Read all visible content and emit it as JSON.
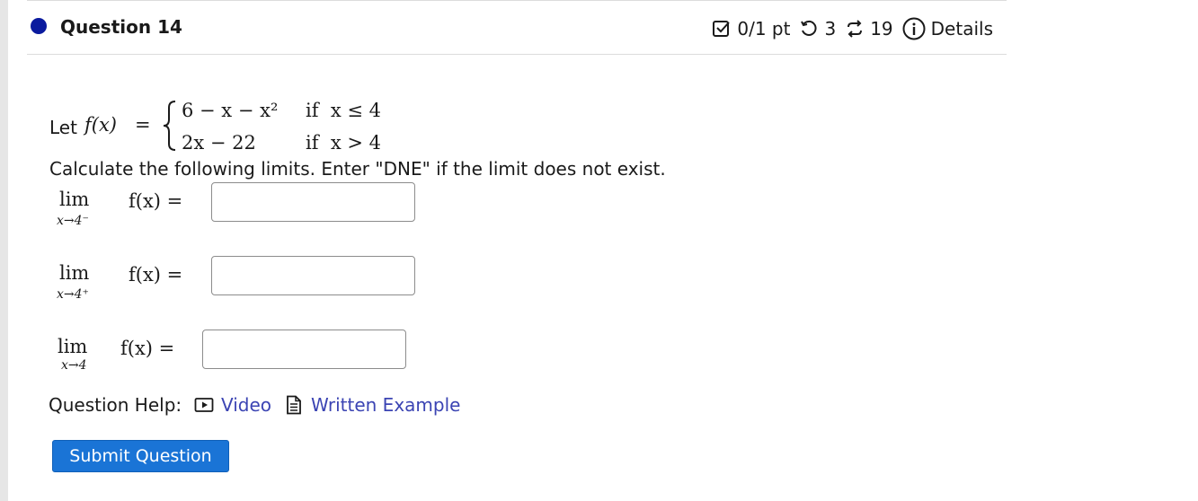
{
  "question": {
    "title": "Question 14",
    "score": "0/1 pt",
    "retries": "3",
    "attempts": "19",
    "details_label": "Details"
  },
  "problem": {
    "let_label": "Let",
    "function_lhs": "f(x)",
    "equals": "=",
    "cases": [
      {
        "expression": "6 − x − x²",
        "condition": "if  x ≤ 4"
      },
      {
        "expression": "2x − 22",
        "condition": "if  x > 4"
      }
    ],
    "instruction": "Calculate the following limits. Enter \"DNE\" if the limit does not exist."
  },
  "limits": [
    {
      "lim_word": "lim",
      "subscript": "x→4⁻",
      "expression": "f(x) =",
      "answer": ""
    },
    {
      "lim_word": "lim",
      "subscript": "x→4⁺",
      "expression": "f(x) =",
      "answer": ""
    },
    {
      "lim_word": "lim",
      "subscript": "x→4",
      "expression": "f(x) =",
      "answer": ""
    }
  ],
  "help": {
    "label": "Question Help:",
    "video_label": "Video",
    "written_example_label": "Written Example"
  },
  "submit_label": "Submit Question",
  "colors": {
    "question_dot": "#0a1a9e",
    "link": "#3b44b3",
    "submit_bg": "#1a74d6"
  }
}
